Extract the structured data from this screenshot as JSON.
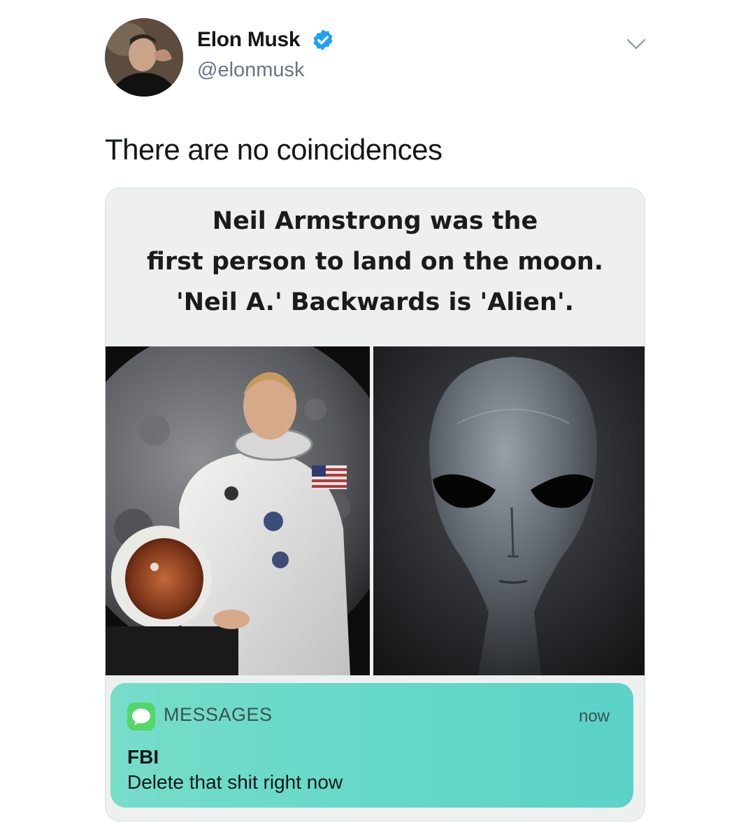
{
  "tweet": {
    "author_name": "Elon Musk",
    "author_handle": "@elonmusk",
    "verified": true,
    "text": "There are no coincidences",
    "menu_icon": "chevron-down-icon"
  },
  "meme": {
    "title_lines": [
      "Neil Armstrong was the",
      "first person to land on the moon.",
      "'Neil A.' Backwards is 'Alien'."
    ],
    "left_image": "astronaut-photo",
    "right_image": "alien-photo"
  },
  "notification": {
    "app_name": "MESSAGES",
    "time": "now",
    "sender": "FBI",
    "message": "Delete that shit right now",
    "app_icon": "messages-app-icon"
  },
  "colors": {
    "verified_blue": "#1da1f2",
    "handle_gray": "#657786",
    "notification_teal": "#66d8c9",
    "messages_green": "#53d769"
  }
}
